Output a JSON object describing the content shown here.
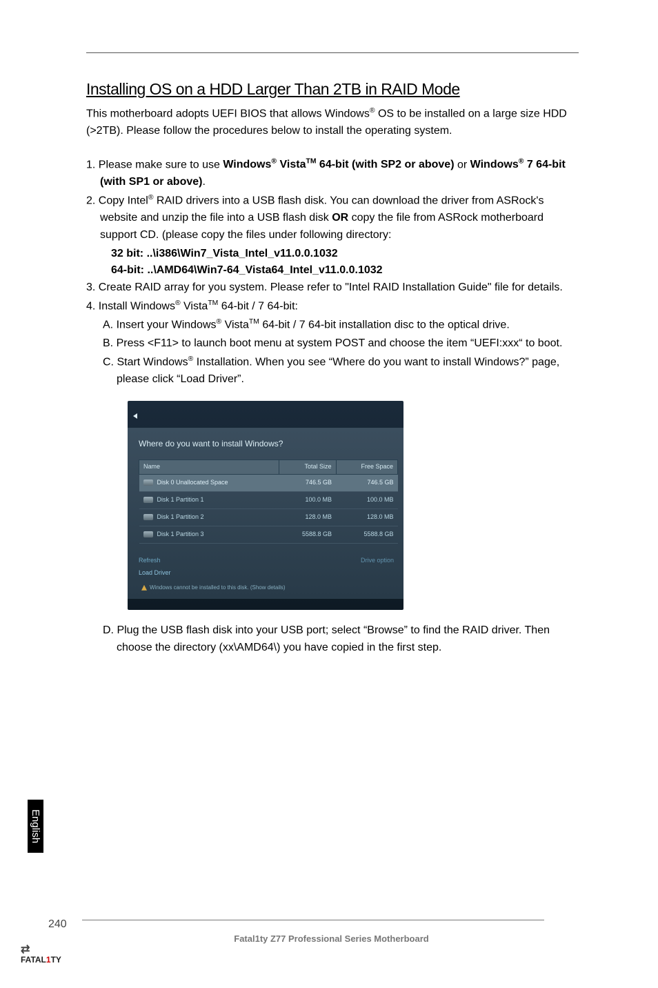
{
  "heading": "Installing OS on a HDD Larger Than 2TB in RAID Mode",
  "intro_parts": {
    "p1": "This motherboard adopts UEFI BIOS that allows Windows",
    "sup1": "®",
    "p2": " OS to be installed on a large size HDD (>2TB). Please follow the procedures below to install the operating system."
  },
  "steps": {
    "s1": {
      "lead": "1. Please make sure to use ",
      "w": "Windows",
      "r": "®",
      "v": " Vista",
      "tm": "TM",
      "txt1": " 64-bit (with SP2 or above)",
      "or": " or ",
      "w2": "Windows",
      "r2": "®",
      "txt2": " 7 64-bit (with SP1 or above)",
      "period": "."
    },
    "s2": {
      "lead": "2. Copy Intel",
      "r": "®",
      "body": " RAID drivers into a USB flash disk. You can download the driver from ASRock's website and unzip the file into a USB flash disk ",
      "or": "OR",
      "body2": " copy the file from ASRock motherboard support CD. (please copy the files under following directory:",
      "path32": "32 bit: ..\\i386\\Win7_Vista_Intel_v11.0.0.1032",
      "path64": "64-bit: ..\\AMD64\\Win7-64_Vista64_Intel_v11.0.0.1032"
    },
    "s3": "3. Create RAID array for you system. Please refer to \"Intel RAID Installation Guide\" file for details.",
    "s4": {
      "lead": "4. Install Windows",
      "r": "®",
      "v": " Vista",
      "tm": "TM",
      "tail": " 64-bit / 7 64-bit:"
    },
    "s4a": {
      "lead": "A. Insert your Windows",
      "r": "®",
      "v": " Vista",
      "tm": "TM",
      "tail": " 64-bit / 7 64-bit installation disc to the optical drive."
    },
    "s4b": "B. Press <F11> to launch boot menu at system POST and choose the item “UEFI:xxx“ to boot.",
    "s4c": {
      "lead": "C. Start Windows",
      "r": "®",
      "tail": " Installation. When you see “Where do you want to install Windows?” page, please click “Load Driver”."
    },
    "s4d": "D. Plug the USB flash disk into your USB port; select “Browse” to find the RAID driver. Then choose the directory (xx\\AMD64\\) you have copied in the first step."
  },
  "screenshot": {
    "title": "Where do you want to install Windows?",
    "cols": {
      "name": "Name",
      "total": "Total Size",
      "free": "Free Space"
    },
    "rows": [
      {
        "name": "Disk 0 Unallocated Space",
        "total": "746.5 GB",
        "free": "746.5 GB",
        "hl": true
      },
      {
        "name": "Disk 1 Partition 1",
        "total": "100.0 MB",
        "free": "100.0 MB",
        "hl": false
      },
      {
        "name": "Disk 1 Partition 2",
        "total": "128.0 MB",
        "free": "128.0 MB",
        "hl": false
      },
      {
        "name": "Disk 1 Partition 3",
        "total": "5588.8 GB",
        "free": "5588.8 GB",
        "hl": false
      }
    ],
    "refresh": "Refresh",
    "load": "Load Driver",
    "drive_options": "Drive option",
    "warn": "Windows cannot be installed to this disk. (Show details)"
  },
  "side_tab": "English",
  "footer": {
    "page": "240",
    "text": "Fatal1ty Z77 Professional Series Motherboard"
  },
  "brand": {
    "main": "FATAL",
    "one": "1",
    "ty": "TY"
  }
}
